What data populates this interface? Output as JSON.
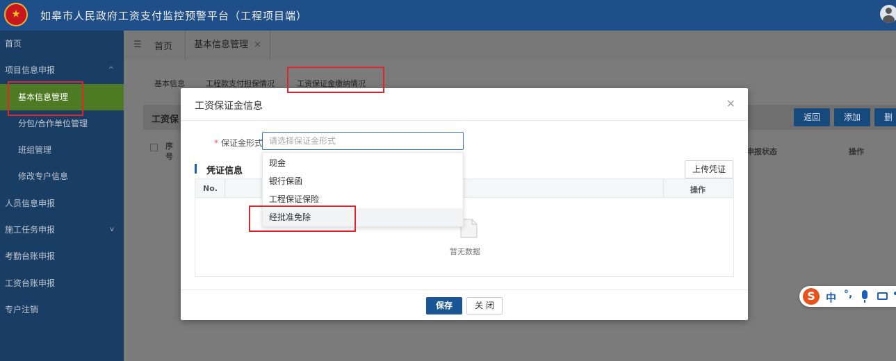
{
  "header": {
    "title": "如皋市人民政府工资支付监控预警平台（工程项目端）"
  },
  "sidebar": {
    "items": [
      {
        "label": "首页",
        "caret": ""
      },
      {
        "label": "项目信息申报",
        "caret": "^"
      },
      {
        "label": "基本信息管理",
        "caret": ""
      },
      {
        "label": "分包/合作单位管理",
        "caret": ""
      },
      {
        "label": "班组管理",
        "caret": ""
      },
      {
        "label": "修改专户信息",
        "caret": ""
      },
      {
        "label": "人员信息申报",
        "caret": ""
      },
      {
        "label": "施工任务申报",
        "caret": "v"
      },
      {
        "label": "考勤台账申报",
        "caret": ""
      },
      {
        "label": "工资台账申报",
        "caret": ""
      },
      {
        "label": "专户注销",
        "caret": ""
      }
    ]
  },
  "tabs": {
    "home": "首页",
    "current": "基本信息管理",
    "close": "×"
  },
  "subtabs": [
    "基本信息",
    "工程款支付担保情况",
    "工资保证金缴纳情况"
  ],
  "background_card": {
    "title": "工资保",
    "buttons": [
      "返回",
      "添加",
      "删"
    ],
    "col_seq": "序号",
    "col_status": "申报状态",
    "col_ops": "操作"
  },
  "dialog": {
    "title": "工资保证金信息",
    "close": "×",
    "field_label": "保证金形式",
    "field_required": "*",
    "field_placeholder": "请选择保证金形式",
    "section_title": "凭证信息",
    "upload_label": "上传凭证",
    "table": {
      "col_no": "No.",
      "col_ops": "操作",
      "empty_text": "暂无数据"
    },
    "save_label": "保存",
    "close_label": "关 闭"
  },
  "dropdown": {
    "options": [
      "现金",
      "银行保函",
      "工程保证保险",
      "经批准免除"
    ],
    "hovered_index": 3
  },
  "ime": {
    "logo": "S",
    "lang": "中",
    "punct": "°,",
    "more": "•"
  },
  "colors": {
    "header_bg": "#1f4f88",
    "sidebar_bg": "#1a3d63",
    "active_item": "#4d7a22",
    "primary_button": "#1b5694",
    "highlight": "#e0262b"
  }
}
